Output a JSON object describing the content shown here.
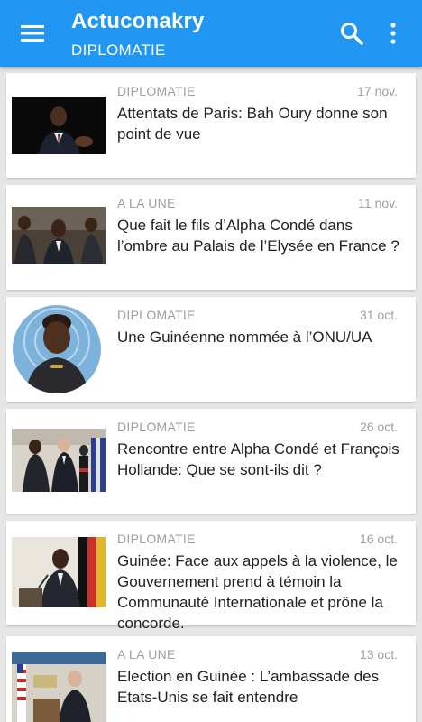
{
  "app": {
    "title": "Actuconakry",
    "section": "DIPLOMATIE",
    "accent_color": "#2196f3",
    "icons": {
      "menu": "hamburger-menu-icon",
      "search": "search-icon",
      "more": "more-vert-icon"
    }
  },
  "articles": [
    {
      "category": "DIPLOMATIE",
      "date": "17 nov.",
      "title": "Attentats de Paris: Bah Oury donne son point de vue"
    },
    {
      "category": "A LA UNE",
      "date": "11 nov.",
      "title": "Que fait le fils d’Alpha Condé dans l’ombre au Palais de l’Elysée en France ?"
    },
    {
      "category": "DIPLOMATIE",
      "date": "31 oct.",
      "title": "Une Guinéenne nommée à l’ONU/UA"
    },
    {
      "category": "DIPLOMATIE",
      "date": "26 oct.",
      "title": "Rencontre entre Alpha Condé et François Hollande: Que se sont-ils dit ?"
    },
    {
      "category": "DIPLOMATIE",
      "date": "16 oct.",
      "title": "Guinée: Face aux appels à la violence, le Gouvernement prend à témoin la Communauté Internationale et prône la concorde."
    },
    {
      "category": "A LA UNE",
      "date": "13 oct.",
      "title": "Election en Guinée : L’ambassade des Etats-Unis se fait entendre"
    }
  ]
}
